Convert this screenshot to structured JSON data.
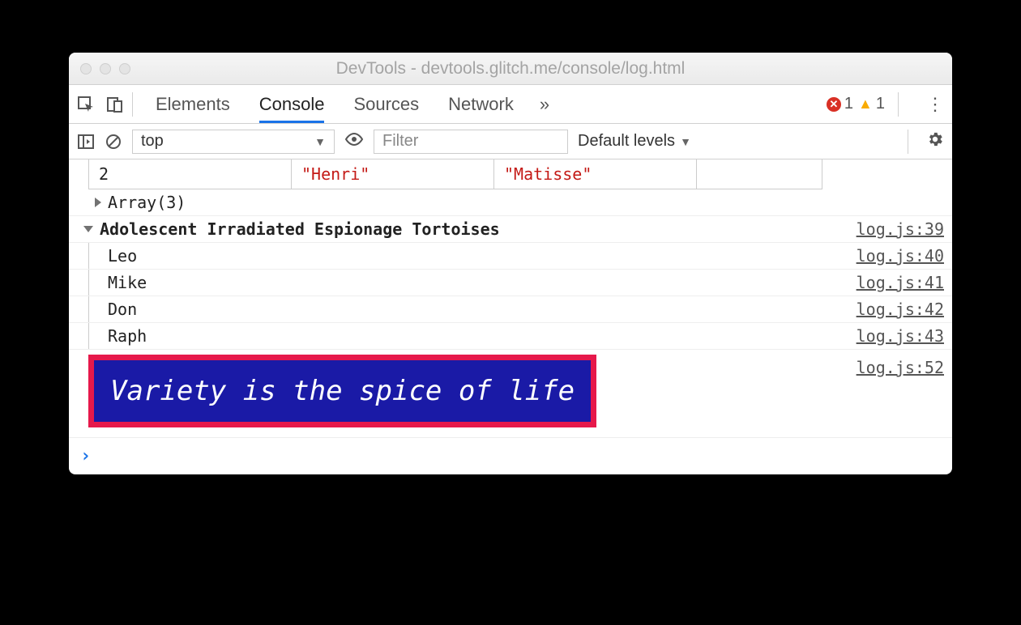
{
  "window": {
    "title": "DevTools - devtools.glitch.me/console/log.html"
  },
  "tabs": {
    "elements": "Elements",
    "console": "Console",
    "sources": "Sources",
    "network": "Network"
  },
  "counts": {
    "errors": "1",
    "warnings": "1"
  },
  "subbar": {
    "context": "top",
    "filter_placeholder": "Filter",
    "levels": "Default levels"
  },
  "table": {
    "index": "2",
    "first": "\"Henri\"",
    "last": "\"Matisse\""
  },
  "array_label": "Array(3)",
  "group": {
    "title": "Adolescent Irradiated Espionage Tortoises",
    "title_src": "log.js:39",
    "items": [
      {
        "text": "Leo",
        "src": "log.js:40"
      },
      {
        "text": "Mike",
        "src": "log.js:41"
      },
      {
        "text": "Don",
        "src": "log.js:42"
      },
      {
        "text": "Raph",
        "src": "log.js:43"
      }
    ]
  },
  "styled": {
    "text": "Variety is the spice of life",
    "src": "log.js:52"
  }
}
